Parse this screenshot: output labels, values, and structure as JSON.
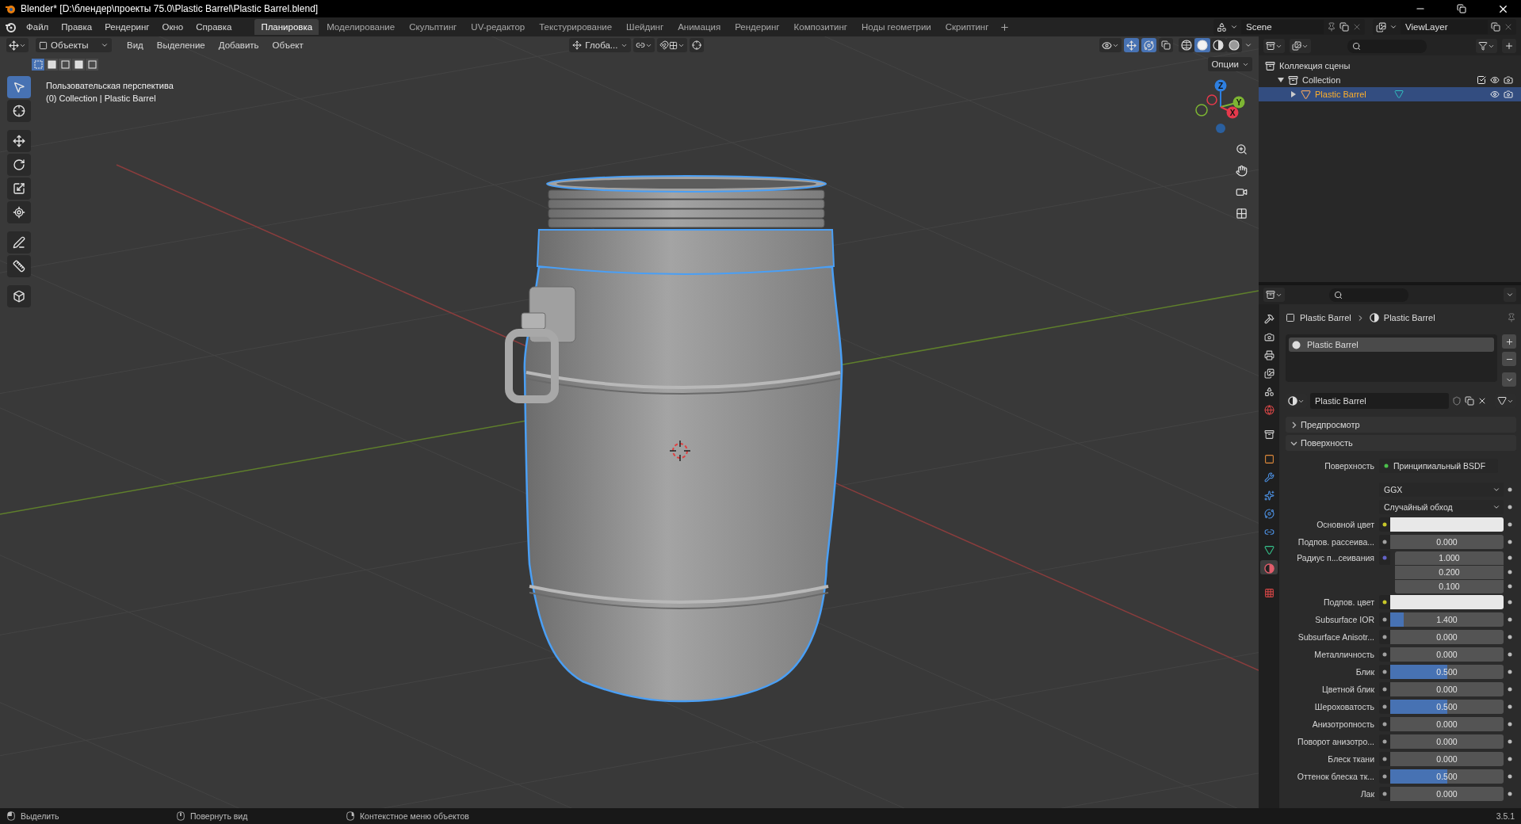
{
  "window": {
    "title": "Blender* [D:\\блендер\\проекты 75.0\\Plastic Barrel\\Plastic Barrel.blend]"
  },
  "menu": [
    "Файл",
    "Правка",
    "Рендеринг",
    "Окно",
    "Справка"
  ],
  "workspaces": [
    {
      "label": "Планировка",
      "selected": true
    },
    {
      "label": "Моделирование",
      "selected": false
    },
    {
      "label": "Скульптинг",
      "selected": false
    },
    {
      "label": "UV-редактор",
      "selected": false
    },
    {
      "label": "Текстурирование",
      "selected": false
    },
    {
      "label": "Шейдинг",
      "selected": false
    },
    {
      "label": "Анимация",
      "selected": false
    },
    {
      "label": "Рендеринг",
      "selected": false
    },
    {
      "label": "Композитинг",
      "selected": false
    },
    {
      "label": "Ноды геометрии",
      "selected": false
    },
    {
      "label": "Скриптинг",
      "selected": false
    }
  ],
  "scene": "Scene",
  "view_layer": "ViewLayer",
  "viewport": {
    "mode": "Объекты",
    "menus": [
      "Вид",
      "Выделение",
      "Добавить",
      "Объект"
    ],
    "orientation": "Глоба...",
    "options": "Опции",
    "select_modes": [
      {
        "selected": true
      },
      {
        "selected": false
      },
      {
        "selected": false
      },
      {
        "selected": false
      },
      {
        "selected": false
      }
    ],
    "tool_groups": [
      [
        {
          "kind": "select",
          "selected": true
        },
        {
          "kind": "cursor",
          "selected": false
        }
      ],
      [
        {
          "kind": "move",
          "selected": false
        },
        {
          "kind": "rotate",
          "selected": false
        },
        {
          "kind": "scale",
          "selected": false
        },
        {
          "kind": "transform",
          "selected": false
        }
      ],
      [
        {
          "kind": "annotate",
          "selected": false
        },
        {
          "kind": "measure",
          "selected": false
        }
      ],
      [
        {
          "kind": "add-cube",
          "selected": false
        }
      ]
    ],
    "shading": [
      {
        "kind": "wireframe",
        "selected": false
      },
      {
        "kind": "solid",
        "selected": true
      },
      {
        "kind": "material",
        "selected": false
      },
      {
        "kind": "rendered",
        "selected": false
      }
    ],
    "info": [
      "Пользовательская перспектива",
      "(0) Collection | Plastic Barrel"
    ],
    "gizmo_axes": [
      {
        "label": "Z",
        "color": "#2e7fe0"
      },
      {
        "label": "Y",
        "color": "#7db533"
      },
      {
        "label": "X",
        "color": "#e5394c"
      }
    ]
  },
  "outliner": {
    "items": [
      {
        "label": "Коллекция сцены",
        "kind": "scene-collection",
        "selected": false,
        "children": [
          {
            "label": "Collection",
            "kind": "collection",
            "expanded": true,
            "selected": false,
            "children": [
              {
                "label": "Plastic Barrel",
                "kind": "mesh-object",
                "expanded": false,
                "selected": true
              }
            ]
          }
        ]
      }
    ]
  },
  "properties": {
    "tabs": [
      {
        "kind": "tool",
        "selected": false
      },
      {
        "kind": "render",
        "selected": false
      },
      {
        "kind": "output",
        "selected": false
      },
      {
        "kind": "view-layer",
        "selected": false
      },
      {
        "kind": "scene",
        "selected": false
      },
      {
        "kind": "world",
        "selected": false
      },
      {
        "kind": "collection",
        "selected": false
      },
      {
        "kind": "object",
        "selected": false
      },
      {
        "kind": "modifiers",
        "selected": false
      },
      {
        "kind": "particles",
        "selected": false
      },
      {
        "kind": "physics",
        "selected": false
      },
      {
        "kind": "constraints",
        "selected": false
      },
      {
        "kind": "data",
        "selected": false
      },
      {
        "kind": "material",
        "selected": true
      },
      {
        "kind": "texture",
        "selected": false
      }
    ],
    "breadcrumb": [
      "Plastic Barrel",
      "Plastic Barrel"
    ],
    "slots": [
      {
        "label": "Plastic Barrel",
        "selected": true
      }
    ],
    "material": "Plastic Barrel",
    "panels": [
      {
        "label": "Предпросмотр",
        "expanded": false
      },
      {
        "label": "Поверхность",
        "expanded": true
      }
    ],
    "surface": {
      "label": "Поверхность",
      "value": "Принципиальный BSDF"
    },
    "dropdowns": [
      "GGX",
      "Случайный обход"
    ],
    "rows": [
      {
        "label": "Основной цвет",
        "kind": "color",
        "color": "#e8e8e8"
      },
      {
        "label": "Подпов. рассеива...",
        "kind": "number",
        "value": "0.000",
        "level": 0
      },
      {
        "label": "Радиус п...сеивания",
        "kind": "vector",
        "values": [
          "1.000",
          "0.200",
          "0.100"
        ]
      },
      {
        "label": "Подпов. цвет",
        "kind": "color",
        "color": "#e8e8e8"
      },
      {
        "label": "Subsurface IOR",
        "kind": "number",
        "value": "1.400",
        "level": 0.12
      },
      {
        "label": "Subsurface Anisotr...",
        "kind": "number",
        "value": "0.000",
        "level": 0
      },
      {
        "label": "Металличность",
        "kind": "number",
        "value": "0.000",
        "level": 0
      },
      {
        "label": "Блик",
        "kind": "number",
        "value": "0.500",
        "level": 0.5
      },
      {
        "label": "Цветной блик",
        "kind": "number",
        "value": "0.000",
        "level": 0
      },
      {
        "label": "Шероховатость",
        "kind": "number",
        "value": "0.500",
        "level": 0.5
      },
      {
        "label": "Анизотропность",
        "kind": "number",
        "value": "0.000",
        "level": 0
      },
      {
        "label": "Поворот анизотро...",
        "kind": "number",
        "value": "0.000",
        "level": 0
      },
      {
        "label": "Блеск ткани",
        "kind": "number",
        "value": "0.000",
        "level": 0
      },
      {
        "label": "Оттенок блеска тк...",
        "kind": "number",
        "value": "0.500",
        "level": 0.5
      },
      {
        "label": "Лак",
        "kind": "number",
        "value": "0.000",
        "level": 0
      }
    ]
  },
  "status_bar": {
    "hints": [
      {
        "kind": "left",
        "label": "Выделить"
      },
      {
        "kind": "middle",
        "label": "Повернуть вид"
      },
      {
        "kind": "right",
        "label": "Контекстное меню объектов"
      }
    ],
    "version": "3.5.1"
  }
}
